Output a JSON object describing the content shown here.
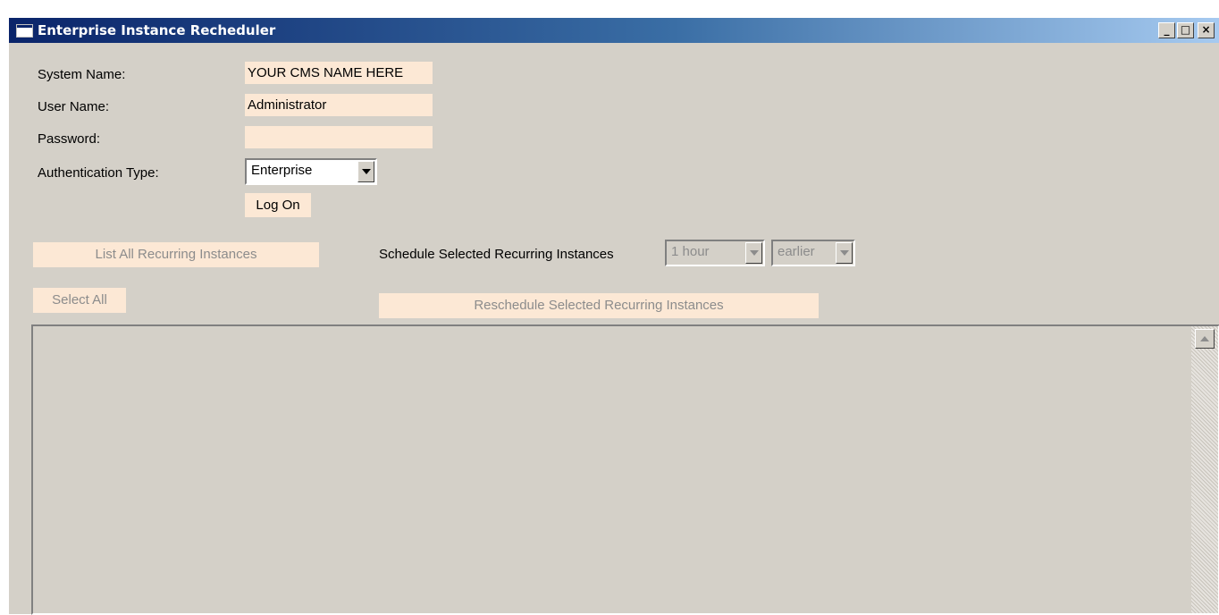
{
  "window": {
    "title": "Enterprise Instance Recheduler",
    "minimize_label": "_",
    "maximize_label": "□",
    "close_label": "×"
  },
  "form": {
    "system_name_label": "System Name:",
    "system_name_value": "YOUR CMS NAME HERE",
    "user_name_label": "User Name:",
    "user_name_value": "Administrator",
    "password_label": "Password:",
    "password_value": "",
    "auth_type_label": "Authentication Type:",
    "auth_type_value": "Enterprise",
    "logon_label": "Log On"
  },
  "actions": {
    "list_all_label": "List All Recurring Instances",
    "schedule_label": "Schedule Selected Recurring Instances",
    "interval_value": "1 hour",
    "direction_value": "earlier",
    "select_all_label": "Select All",
    "reschedule_label": "Reschedule Selected Recurring Instances"
  },
  "colors": {
    "window_bg": "#d4d0c8",
    "field_bg": "#fce8d5",
    "title_start": "#0a246a",
    "title_end": "#a6caf0",
    "disabled_text": "#8c8c8c"
  }
}
